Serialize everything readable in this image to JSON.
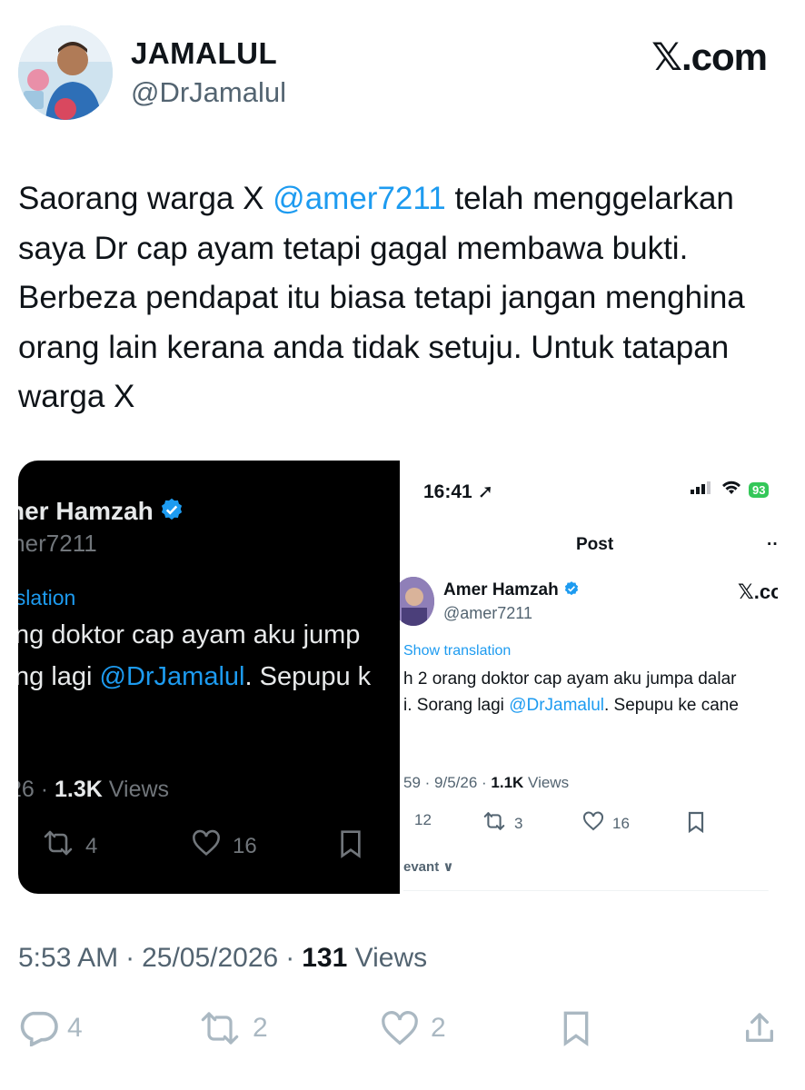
{
  "author": {
    "name": "JAMALUL",
    "handle": "@DrJamalul"
  },
  "brand": "𝕏.com",
  "tweet": {
    "text_before": "Saorang warga X ",
    "mention": "@amer7211",
    "text_after": " telah menggelarkan saya Dr cap ayam tetapi gagal membawa bukti. Berbeza pendapat itu biasa tetapi jangan menghina orang lain kerana anda tidak setuju. Untuk tatapan warga X"
  },
  "dark_shot": {
    "name": "ner Hamzah",
    "handle": "mer7211",
    "translation": "nslation",
    "line1": "ng doktor cap ayam aku jump",
    "line2_before": "ng lagi ",
    "line2_mention": "@DrJamalul",
    "line2_after": ". Sepupu k",
    "meta_date": "26 · ",
    "meta_views_count": "1.3K",
    "meta_views_label": " Views",
    "retweets": "4",
    "likes": "16"
  },
  "light_shot": {
    "time": "16:41",
    "battery": "93",
    "header": "Post",
    "more": "··",
    "name": "Amer Hamzah",
    "handle": "@amer7211",
    "brand": "𝕏.coı",
    "translation": "Show translation",
    "line1": "h 2 orang doktor cap ayam aku jumpa dalar",
    "line2_before": "i. Sorang lagi ",
    "line2_mention": "@DrJamalul",
    "line2_after": ". Sepupu ke cane",
    "meta_date": "59 · 9/5/26 · ",
    "meta_views_count": "1.1K",
    "meta_views_label": " Views",
    "replies": "12",
    "retweets": "3",
    "likes": "16",
    "relevant": "evant ∨"
  },
  "footer": {
    "time": "5:53 AM",
    "date": "25/05/2026",
    "views_count": "131",
    "views_label": "Views",
    "replies": "4",
    "retweets": "2",
    "likes": "2"
  },
  "colors": {
    "accent": "#1d9bf0",
    "text": "#0f1419",
    "muted": "#536471",
    "icon": "#aab8c2"
  }
}
